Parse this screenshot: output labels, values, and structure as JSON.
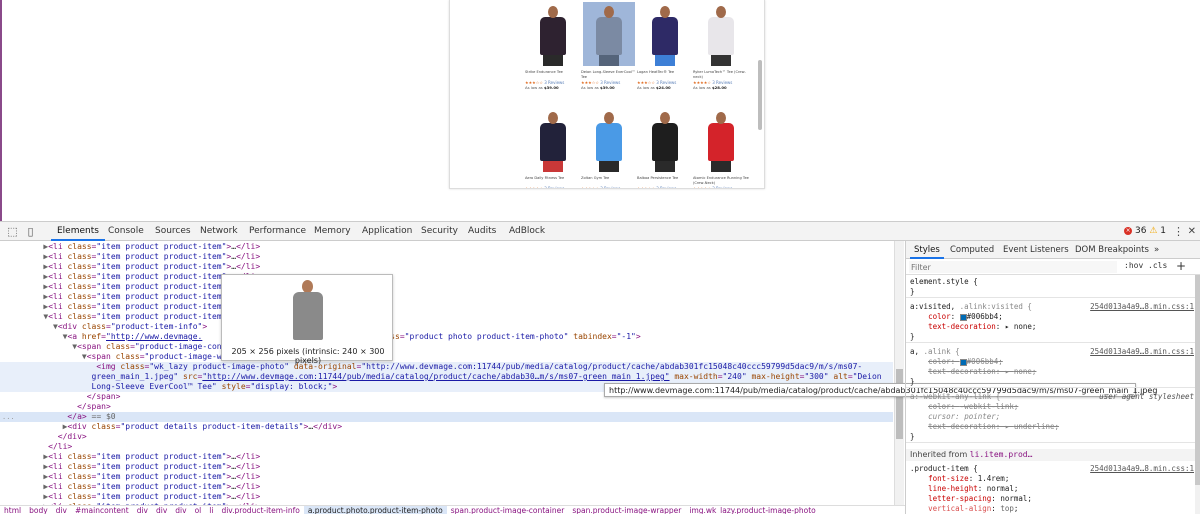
{
  "page": {
    "products": [
      {
        "name": "Strike Endurance Tee",
        "stars": "★★★☆☆",
        "reviews": "3 Reviews",
        "price_label": "As low as",
        "price": "$39.00",
        "shirt": "#2e2230",
        "pants": "#2a2a2a",
        "highlight": false
      },
      {
        "name": "Deion Long-Sleeve EverCool™ Tee",
        "stars": "★★★☆☆",
        "reviews": "3 Reviews",
        "price_label": "As low as",
        "price": "$39.00",
        "shirt": "#7b8aa3",
        "pants": "#55647a",
        "highlight": true
      },
      {
        "name": "Logan HeatTec® Tee",
        "stars": "★★★☆☆",
        "reviews": "3 Reviews",
        "price_label": "As low as",
        "price": "$24.00",
        "shirt": "#2e2a66",
        "pants": "#3d7fd6",
        "highlight": false
      },
      {
        "name": "Ryker LumaTech™ Tee (Crew-neck)",
        "stars": "★★★★☆",
        "reviews": "3 Reviews",
        "price_label": "As low as",
        "price": "$28.00",
        "shirt": "#e8e6ea",
        "pants": "#333333",
        "highlight": false
      },
      {
        "name": "Aero Daily Fitness Tee",
        "stars": "★★★★☆",
        "reviews": "3 Reviews",
        "price_label": "",
        "price": "",
        "shirt": "#22223a",
        "pants": "#c93838",
        "highlight": false
      },
      {
        "name": "Zoltan Gym Tee",
        "stars": "★★★☆☆",
        "reviews": "3 Reviews",
        "price_label": "",
        "price": "",
        "shirt": "#4a9ae6",
        "pants": "#2a2a2a",
        "highlight": false
      },
      {
        "name": "Balboa Persistence Tee",
        "stars": "★★★☆☆",
        "reviews": "3 Reviews",
        "price_label": "",
        "price": "",
        "shirt": "#1e1e1e",
        "pants": "#2a2a2a",
        "highlight": false
      },
      {
        "name": "Atomic Endurance Running Tee (Crew-Neck)",
        "stars": "★★★★☆",
        "reviews": "3 Reviews",
        "price_label": "",
        "price": "",
        "shirt": "#d4232a",
        "pants": "#2a2a2a",
        "highlight": false
      }
    ]
  },
  "devtools": {
    "tabs": [
      "Elements",
      "Console",
      "Sources",
      "Network",
      "Performance",
      "Memory",
      "Application",
      "Security",
      "Audits",
      "AdBlock"
    ],
    "active_tab": "Elements",
    "error_count": "36",
    "warning_count": "1",
    "tree": {
      "li_line": {
        "open": "<li ",
        "attr": "class",
        "eq": "=\"",
        "val": "item product product-item",
        "close": "\">",
        "dots": "…",
        "end": "</li>"
      },
      "div_info": {
        "open": "<div ",
        "attr": "class",
        "val": "product-item-info"
      },
      "a_open": {
        "open": "<a ",
        "attr1": "href",
        "href": "http://www.devmage.com:11744/deion-long-sleeve-evercool-trade-tee.html",
        "href_visible": "http://www.devmage.",
        "href_tail": "trade-tee.html",
        "attr2": "class",
        "cls": "product photo product-item-photo",
        "attr3": "tabindex",
        "tab": "-1"
      },
      "span1": {
        "open": "<span ",
        "attr": "class",
        "val": "product-image-container"
      },
      "span2": {
        "open": "<span ",
        "attr": "class",
        "val": "product-image-wrapper",
        "tail": "%;\">"
      },
      "img": {
        "open": "<img ",
        "cls_attr": "class",
        "cls": "wk_lazy product-image-photo",
        "data_attr": "data-original",
        "data": "http://www.devmage.com:11744/pub/media/catalog/product/cache/abdab301fc15048c40ccc59799d5dac9/m/s/ms07-",
        "data2": "green_main_1.jpeg",
        "src_attr": "src",
        "src": "http://www.devmage.com:11744/pub/media/catalog/product/cache/abdab30…m/s/ms07-green_main_1.jpeg",
        "mw_attr": "max-width",
        "mw": "240",
        "mh_attr": "max-height",
        "mh": "300",
        "alt_attr": "alt",
        "alt": "Deion Long-Sleeve EverCool™ Tee",
        "style_attr": "style",
        "style": "display: block;"
      },
      "close_span": "</span>",
      "close_a": "</a>",
      "selected_marker": "== $0",
      "details": {
        "open": "<div ",
        "attr": "class",
        "val": "product details product-item-details",
        "end": "</div>"
      },
      "close_div": "</div>",
      "close_li": "</li>",
      "gutter": "..."
    },
    "img_tooltip": "205 × 256 pixels (intrinsic: 240 × 300 pixels)",
    "url_tooltip": "http://www.devmage.com:11744/pub/media/catalog/product/cache/abdab301fc15048c40ccc59799d5dac9/m/s/ms07-green_main_1.jpeg",
    "breadcrumbs": [
      "html",
      "body",
      "div",
      "#maincontent",
      "div",
      "div",
      "div",
      "ol",
      "li",
      "div.product-item-info",
      "a.product.photo.product-item-photo",
      "span.product-image-container",
      "span.product-image-wrapper",
      "img.wk_lazy.product-image-photo"
    ],
    "active_breadcrumb": 10,
    "styles": {
      "tabs": [
        "Styles",
        "Computed",
        "Event Listeners",
        "DOM Breakpoints"
      ],
      "more": "»",
      "filter_placeholder": "Filter",
      "hov": ":hov",
      "cls": ".cls",
      "plus": "+",
      "element_style": "element.style {",
      "brace_close": "}",
      "rule1": {
        "selector": "a:visited,",
        "selector_dim": " .alink:visited {",
        "source": "254d013a4a9…8.min.css:1",
        "p1": "color",
        "v1": "#006bb4",
        "p2": "text-decoration",
        "v2": "none"
      },
      "rule2": {
        "selector": "a,",
        "selector_dim": " .alink {",
        "source": "254d013a4a9…8.min.css:1",
        "p1": "color",
        "v1": "#006bb4",
        "p2": "text-decoration",
        "v2": "none"
      },
      "rule3": {
        "selector": "a:-webkit-any-link {",
        "source": "user agent stylesheet",
        "p1": "color",
        "v1": "-webkit-link",
        "p2": "cursor",
        "v2": "pointer",
        "p3": "text-decoration",
        "v3": "underline"
      },
      "inherited_label": "Inherited from ",
      "inherited_from": "li.item.prod…",
      "rule4": {
        "selector": ".product-item {",
        "source": "254d013a4a9…8.min.css:1",
        "p1": "font-size",
        "v1": "1.4rem",
        "p2": "line-height",
        "v2": "normal",
        "p3": "letter-spacing",
        "v3": "normal",
        "p4": "vertical-align",
        "v4": "top"
      }
    }
  }
}
